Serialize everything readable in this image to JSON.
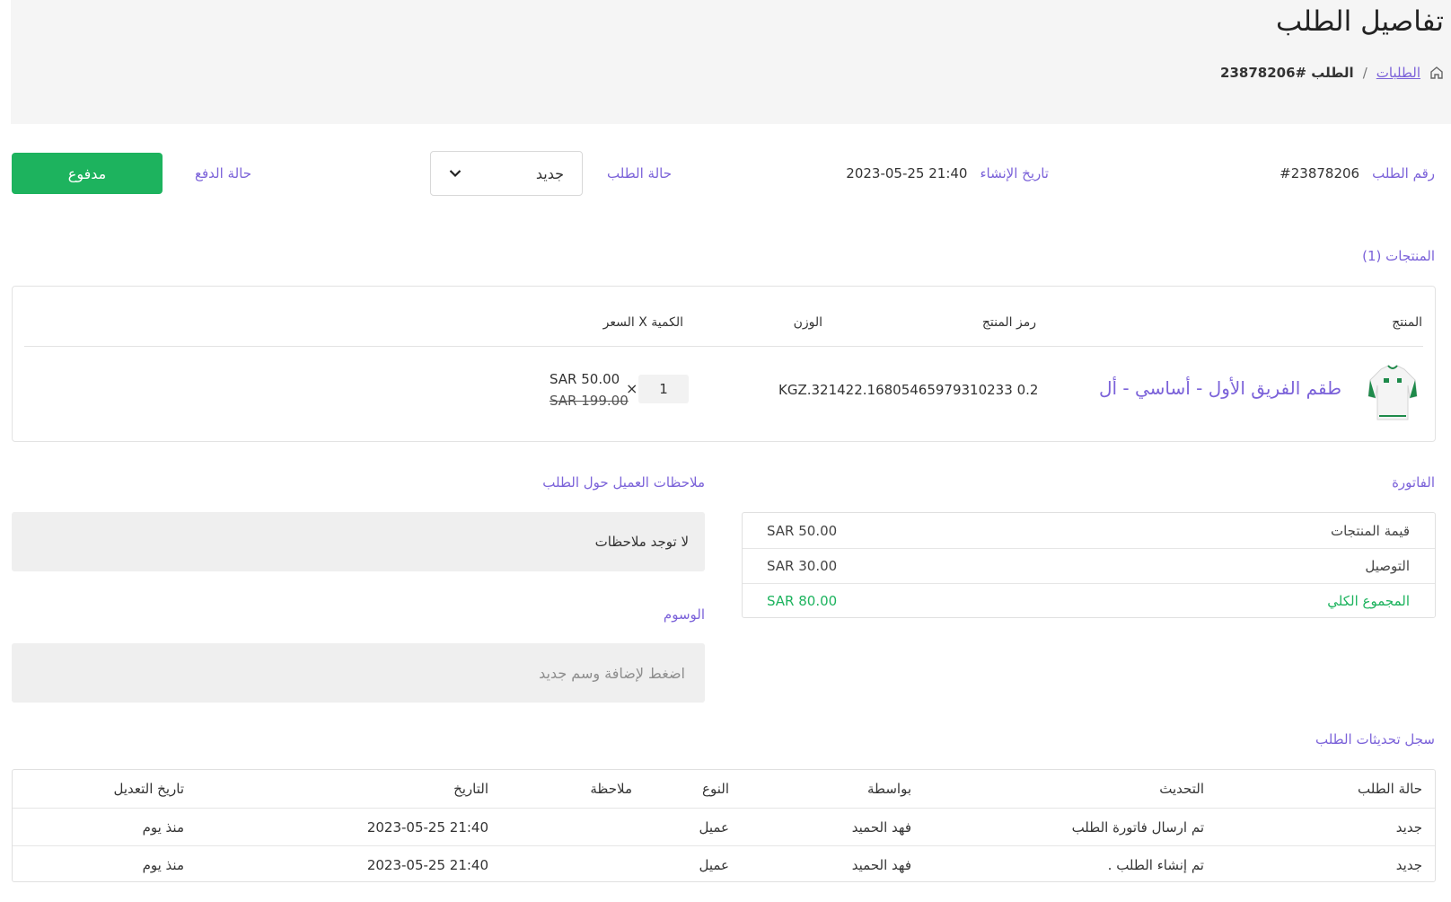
{
  "header": {
    "title": "تفاصيل الطلب",
    "breadcrumb": {
      "orders_link": "الطلبات",
      "separator": "/",
      "current": "الطلب #23878206"
    }
  },
  "summary": {
    "order_number_label": "رقم الطلب",
    "order_number_value": "#23878206",
    "created_label": "تاريخ الإنشاء",
    "created_value": "2023-05-25 21:40",
    "order_status_label": "حالة الطلب",
    "order_status_value": "جديد",
    "payment_status_label": "حالة الدفع",
    "payment_status_value": "مدفوع"
  },
  "products": {
    "section_title": "المنتجات (1)",
    "columns": {
      "product": "المنتج",
      "sku": "رمز المنتج",
      "weight": "الوزن",
      "qty_price": "الكمية X السعر"
    },
    "items": [
      {
        "name": "طقم الفريق الأول - أساسي - أل",
        "sku_weight": "0.2 KGZ.321422.16805465979310233",
        "quantity": "1",
        "times": "×",
        "price": "SAR 50.00",
        "old_price": "SAR 199.00"
      }
    ]
  },
  "invoice": {
    "section_title": "الفاتورة",
    "rows": [
      {
        "label": "قيمة المنتجات",
        "value": "SAR 50.00"
      },
      {
        "label": "التوصيل",
        "value": "SAR 30.00"
      },
      {
        "label": "المجموع الكلي",
        "value": "SAR 80.00"
      }
    ]
  },
  "notes": {
    "section_title": "ملاحظات العميل حول الطلب",
    "text": "لا توجد ملاحظات"
  },
  "tags": {
    "section_title": "الوسوم",
    "placeholder": "اضغط لإضافة وسم جديد"
  },
  "history": {
    "section_title": "سجل تحديثات الطلب",
    "columns": {
      "status": "حالة الطلب",
      "update": "التحديث",
      "by": "بواسطة",
      "type": "النوع",
      "note": "ملاحظة",
      "date": "التاريخ",
      "modified": "تاريخ التعديل"
    },
    "rows": [
      {
        "status": "جديد",
        "update": "تم ارسال فاتورة الطلب",
        "by": "فهد الحميد",
        "type": "عميل",
        "note": "",
        "date": "2023-05-25 21:40",
        "modified": "منذ يوم"
      },
      {
        "status": "جديد",
        "update": "تم إنشاء الطلب .",
        "by": "فهد الحميد",
        "type": "عميل",
        "note": "",
        "date": "2023-05-25 21:40",
        "modified": "منذ يوم"
      }
    ]
  },
  "colors": {
    "accent": "#7b62d9",
    "success": "#1db35e",
    "header_bg": "#f5f5f5"
  }
}
